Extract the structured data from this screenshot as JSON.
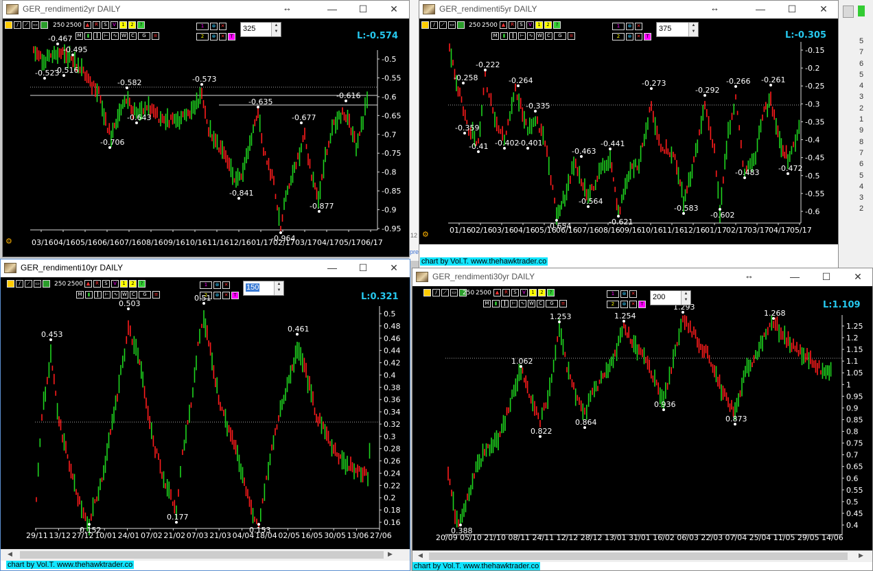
{
  "toolbar_common": {
    "bars_label": "250",
    "bars_label2": "2500",
    "btn_labels": [
      "MM",
      "R",
      "T1",
      "T2",
      "T?",
      "Ev1",
      "Ev2",
      "W",
      "C",
      "Gap"
    ]
  },
  "credit_text": "chart by Vol.T. www.thehawktrader.co",
  "windows": [
    {
      "title": "GER_rendimenti2yr DAILY",
      "spin_value": "325",
      "last_label": "L:-0.574",
      "y_ticks": [
        "-0.5",
        "-0.55",
        "-0.6",
        "-0.65",
        "-0.7",
        "-0.75",
        "-0.8",
        "-0.85",
        "-0.9",
        "-0.95"
      ],
      "x_ticks": [
        "03/16",
        "04/16",
        "05/16",
        "06/16",
        "07/16",
        "08/16",
        "09/16",
        "10/16",
        "11/16",
        "12/16",
        "01/17",
        "02/17",
        "03/17",
        "04/17",
        "05/17",
        "06/17"
      ],
      "annotations": [
        "-0.467",
        "-0.495",
        "-0.523",
        "-0.516",
        "-0.582",
        "-0.573",
        "-0.643",
        "-0.706",
        "-0.635",
        "-0.616",
        "-0.677",
        "-0.841",
        "-0.877",
        "-0.964"
      ]
    },
    {
      "title": "GER_rendimenti5yr DAILY",
      "spin_value": "375",
      "last_label": "L:-0.305",
      "y_ticks": [
        "-0.15",
        "-0.2",
        "-0.25",
        "-0.3",
        "-0.35",
        "-0.4",
        "-0.45",
        "-0.5",
        "-0.55",
        "-0.6"
      ],
      "x_ticks": [
        "01/16",
        "02/16",
        "03/16",
        "04/16",
        "05/16",
        "06/16",
        "07/16",
        "08/16",
        "09/16",
        "10/16",
        "11/16",
        "12/16",
        "01/17",
        "02/17",
        "03/17",
        "04/17",
        "05/17"
      ],
      "annotations": [
        "-0.258",
        "-0.222",
        "-0.264",
        "-0.335",
        "-0.359",
        "-0.41",
        "-0.402",
        "-0.401",
        "-0.463",
        "-0.441",
        "-0.273",
        "-0.292",
        "-0.266",
        "-0.261",
        "-0.564",
        "-0.654",
        "-0.621",
        "-0.583",
        "-0.602",
        "-0.483",
        "-0.472"
      ]
    },
    {
      "title": "GER_rendimenti10yr DAILY",
      "spin_value": "150",
      "last_label": "L:0.321",
      "y_ticks": [
        "0.5",
        "0.48",
        "0.46",
        "0.44",
        "0.42",
        "0.4",
        "0.38",
        "0.36",
        "0.34",
        "0.32",
        "0.3",
        "0.28",
        "0.26",
        "0.24",
        "0.22",
        "0.2",
        "0.18",
        "0.16"
      ],
      "x_ticks": [
        "29/11",
        "13/12",
        "27/12",
        "10/01",
        "24/01",
        "07/02",
        "21/02",
        "07/03",
        "21/03",
        "04/04",
        "18/04",
        "02/05",
        "16/05",
        "30/05",
        "13/06",
        "27/06"
      ],
      "annotations": [
        "0.453",
        "0.503",
        "0.51",
        "0.461",
        "0.177",
        "0.152",
        "0.153"
      ]
    },
    {
      "title": "GER_rendimenti30yr DAILY",
      "spin_value": "200",
      "last_label": "L:1.109",
      "y_ticks": [
        "1.25",
        "1.2",
        "1.15",
        "1.1",
        "1.05",
        "1",
        "0.95",
        "0.9",
        "0.85",
        "0.8",
        "0.75",
        "0.7",
        "0.65",
        "0.6",
        "0.55",
        "0.5",
        "0.45",
        "0.4"
      ],
      "x_ticks": [
        "20/09",
        "05/10",
        "21/10",
        "08/11",
        "24/11",
        "12/12",
        "28/12",
        "13/01",
        "31/01",
        "16/02",
        "06/03",
        "22/03",
        "07/04",
        "25/04",
        "11/05",
        "29/05",
        "14/06"
      ],
      "annotations": [
        "1.062",
        "1.253",
        "1.254",
        "1.293",
        "1.268",
        "0.822",
        "0.864",
        "0.936",
        "0.873",
        "0.388"
      ]
    }
  ],
  "side_strip": [
    "5",
    "7",
    "6",
    "5",
    "4",
    "3",
    "2",
    "1",
    "9",
    "8",
    "7",
    "6",
    "5",
    "4",
    "3",
    "2"
  ],
  "strip_text": [
    "12",
    "pre"
  ],
  "colors": {
    "up": "#1fd41f",
    "down": "#ff1c1c",
    "bg": "#000000",
    "last": "#26c8ee",
    "credit_bg": "#12e5ff"
  }
}
